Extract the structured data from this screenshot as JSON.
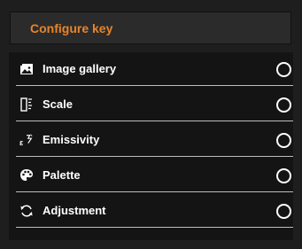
{
  "header": {
    "title": "Configure key"
  },
  "items": [
    {
      "label": "Image gallery",
      "icon": "image-gallery-icon",
      "selected": false
    },
    {
      "label": "Scale",
      "icon": "scale-icon",
      "selected": false
    },
    {
      "label": "Emissivity",
      "icon": "emissivity-icon",
      "selected": false
    },
    {
      "label": "Palette",
      "icon": "palette-icon",
      "selected": false
    },
    {
      "label": "Adjustment",
      "icon": "adjustment-icon",
      "selected": false
    }
  ],
  "colors": {
    "accent": "#e8842a",
    "background": "#1e1e1e",
    "text": "#ffffff"
  }
}
